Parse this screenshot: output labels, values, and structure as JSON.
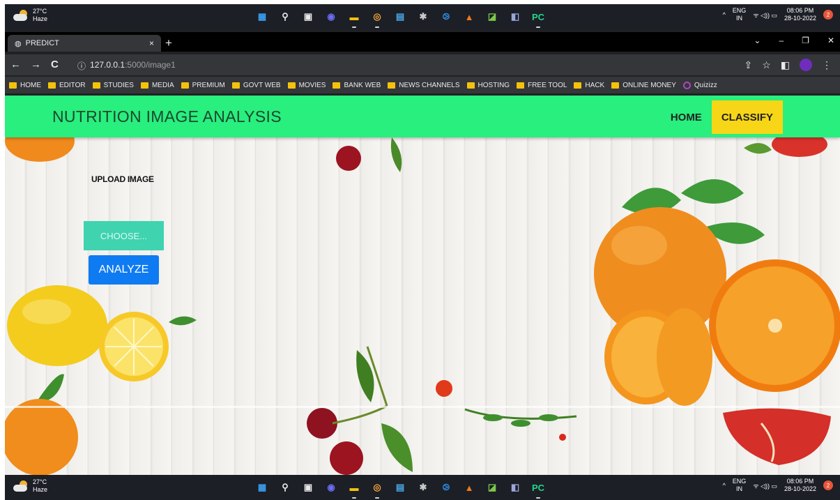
{
  "taskbar": {
    "weather_temp": "27°C",
    "weather_desc": "Haze",
    "apps": [
      {
        "name": "windows-start-icon",
        "glyph": "▦",
        "color": "#3aa0f0"
      },
      {
        "name": "search-icon",
        "glyph": "⚲",
        "color": "#e8e8e8"
      },
      {
        "name": "task-view-icon",
        "glyph": "▣",
        "color": "#e8e8e8"
      },
      {
        "name": "chat-icon",
        "glyph": "◉",
        "color": "#6b6ef2"
      },
      {
        "name": "file-explorer-icon",
        "glyph": "▬",
        "color": "#f4c20d"
      },
      {
        "name": "chrome-icon",
        "glyph": "◎",
        "color": "#f2a33a"
      },
      {
        "name": "store-icon",
        "glyph": "▤",
        "color": "#4aa8e8"
      },
      {
        "name": "settings-icon",
        "glyph": "✱",
        "color": "#c9c9c9"
      },
      {
        "name": "vscode-icon",
        "glyph": "⧁",
        "color": "#2f8de4"
      },
      {
        "name": "vlc-icon",
        "glyph": "▲",
        "color": "#f07a1a"
      },
      {
        "name": "editor-icon",
        "glyph": "◪",
        "color": "#7cc94a"
      },
      {
        "name": "tool-icon",
        "glyph": "◧",
        "color": "#9aa7d8"
      },
      {
        "name": "pycharm-icon",
        "glyph": "PC",
        "color": "#21d789"
      }
    ],
    "tray_arrow": "^",
    "lang_top": "ENG",
    "lang_bottom": "IN",
    "tray_icons": "ᯤ ◁)) ▭",
    "time": "08:06 PM",
    "date": "28-10-2022",
    "notifications": "2"
  },
  "browser": {
    "tab_title": "PREDICT",
    "tab_close": "×",
    "new_tab": "+",
    "window_controls": [
      "⌄",
      "–",
      "❐",
      "✕"
    ],
    "nav_back": "←",
    "nav_forward": "→",
    "nav_reload": "C",
    "info_icon": "ⓘ",
    "url_host": "127.0.0.1",
    "url_path": ":5000/image1",
    "bookmarks": [
      "HOME",
      "EDITOR",
      "STUDIES",
      "MEDIA",
      "PREMIUM",
      "GOVT WEB",
      "MOVIES",
      "BANK WEB",
      "NEWS CHANNELS",
      "HOSTING",
      "FREE TOOL",
      "HACK",
      "ONLINE MONEY"
    ],
    "bookmark_quiz": "Quizizz"
  },
  "site": {
    "title": "NUTRITION IMAGE ANALYSIS",
    "nav": {
      "home": "HOME",
      "classify": "CLASSIFY"
    },
    "upload_label": "UPLOAD IMAGE",
    "choose_button": "CHOOSE...",
    "analyze_button": "ANALYZE"
  },
  "colors": {
    "header_green": "#28ef7d",
    "classify_yellow": "#f7d617",
    "choose_teal": "#3fd3b0",
    "analyze_blue": "#0e7bf2"
  }
}
